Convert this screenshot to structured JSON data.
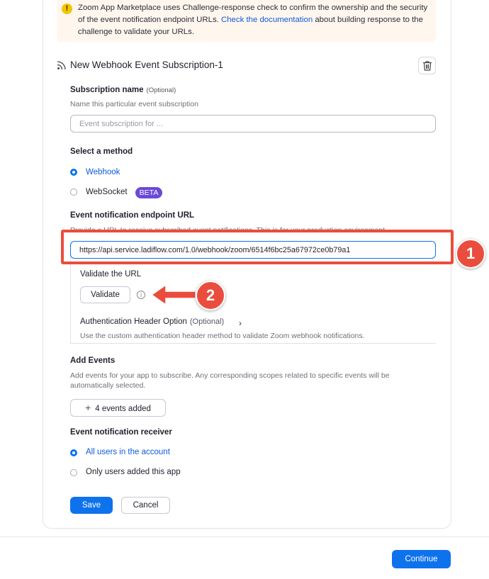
{
  "notice": {
    "text_before": "Zoom App Marketplace uses Challenge-response check to confirm the ownership and the security of the event notification endpoint URLs. ",
    "link": "Check the documentation",
    "text_after": " about building response to the challenge to validate your URLs."
  },
  "subscription": {
    "title": "New Webhook Event Subscription-1",
    "name_label": "Subscription name",
    "name_optional": "(Optional)",
    "name_help": "Name this particular event subscription",
    "name_placeholder": "Event subscription for ..."
  },
  "method": {
    "label": "Select a method",
    "options": [
      {
        "label": "Webhook",
        "selected": true
      },
      {
        "label": "WebSocket",
        "selected": false
      }
    ],
    "beta_badge": "BETA"
  },
  "endpoint": {
    "label": "Event notification endpoint URL",
    "help": "Provide a URL to receive subscribed event notifications. This is for your production environment.",
    "value": "https://api.service.ladiflow.com/1.0/webhook/zoom/6514f6bc25a67972ce0b79a1",
    "validate_label": "Validate the URL",
    "validate_button": "Validate",
    "auth_option": "Authentication Header Option",
    "auth_optional": "(Optional)",
    "auth_help": "Use the custom authentication header method to validate Zoom webhook notifications."
  },
  "events": {
    "label": "Add Events",
    "help_line1": "Add events for your app to subscribe. Any corresponding scopes related to specific events will be",
    "help_line2": "automatically selected.",
    "button": "4 events added"
  },
  "receiver": {
    "label": "Event notification receiver",
    "options": [
      {
        "label": "All users in the account",
        "selected": true
      },
      {
        "label": "Only users added this app",
        "selected": false
      }
    ]
  },
  "actions": {
    "save": "Save",
    "cancel": "Cancel",
    "continue": "Continue"
  },
  "annotations": {
    "step1": "1",
    "step2": "2",
    "color": "#ea4d3d"
  },
  "colors": {
    "primary": "#0e72ed",
    "link": "#0e5bd8",
    "beta": "#6b49d8",
    "notice_bg": "#fff6ee"
  }
}
